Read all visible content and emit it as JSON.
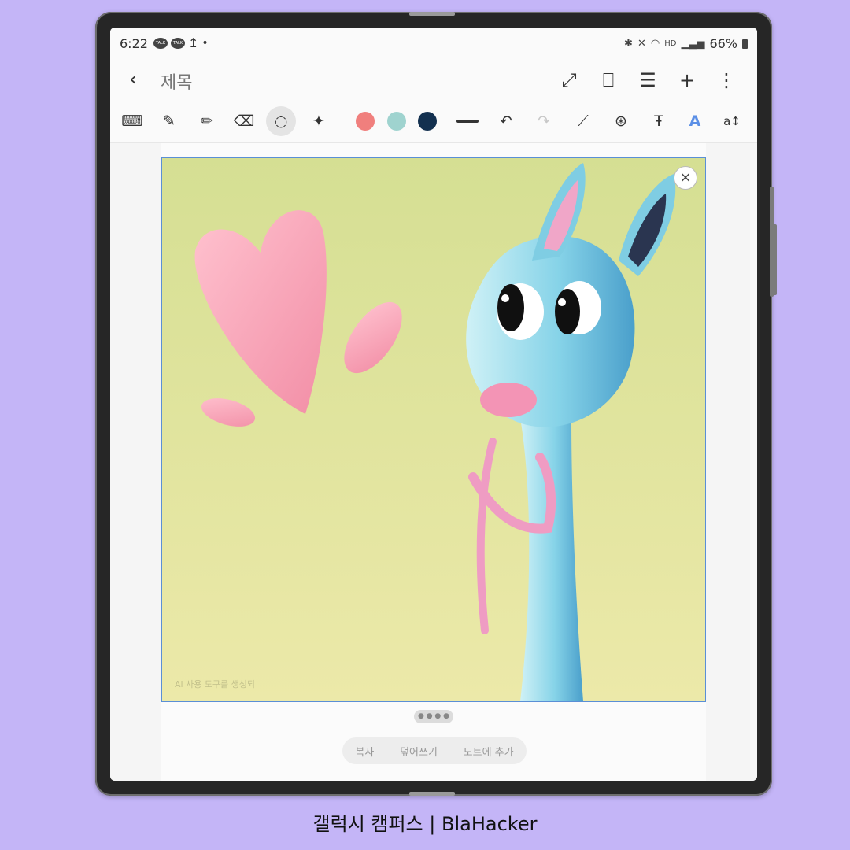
{
  "status_bar": {
    "time": "6:22",
    "talk_badge": "TALK",
    "upload_glyph": "↥",
    "dot": "•",
    "hd_label": "HD",
    "battery": "66%"
  },
  "title_bar": {
    "back_glyph": "‹",
    "title": "제목",
    "actions": [
      {
        "icon": "expand-icon",
        "glyph": "⤢"
      },
      {
        "icon": "book-view-icon",
        "glyph": "⎕"
      },
      {
        "icon": "page-layout-icon",
        "glyph": "☰"
      },
      {
        "icon": "add-icon",
        "glyph": "+"
      },
      {
        "icon": "more-options-icon",
        "glyph": "⋮"
      }
    ]
  },
  "toolbar": {
    "tools": [
      {
        "icon": "keyboard-icon",
        "glyph": "⌨"
      },
      {
        "icon": "pen-icon",
        "glyph": "✎"
      },
      {
        "icon": "highlighter-icon",
        "glyph": "✏"
      },
      {
        "icon": "eraser-icon",
        "glyph": "⌫"
      },
      {
        "icon": "lasso-select-icon",
        "glyph": "◌"
      },
      {
        "icon": "ai-sparkle-icon",
        "glyph": "✦"
      }
    ],
    "colors": [
      "#f07f7d",
      "#9fd3cf",
      "#13304f"
    ],
    "undo_glyph": "↶",
    "redo_glyph": "↷",
    "extra": [
      {
        "icon": "shape-pen-icon",
        "glyph": "⟋"
      },
      {
        "icon": "pen-settings-icon",
        "glyph": "⊛"
      },
      {
        "icon": "text-pen-icon",
        "glyph": "Ŧ"
      },
      {
        "icon": "text-style-icon",
        "glyph": "A"
      },
      {
        "icon": "text-size-icon",
        "glyph": "a↕"
      }
    ]
  },
  "image": {
    "close_glyph": "×",
    "watermark": "Ai 사용 도구를 생성되",
    "pager": "● ● ● ●"
  },
  "action_bar": {
    "copy": "복사",
    "overwrite": "덮어쓰기",
    "add_to_note": "노트에 추가"
  },
  "caption": "갤럭시 캠퍼스 | BlaHacker"
}
